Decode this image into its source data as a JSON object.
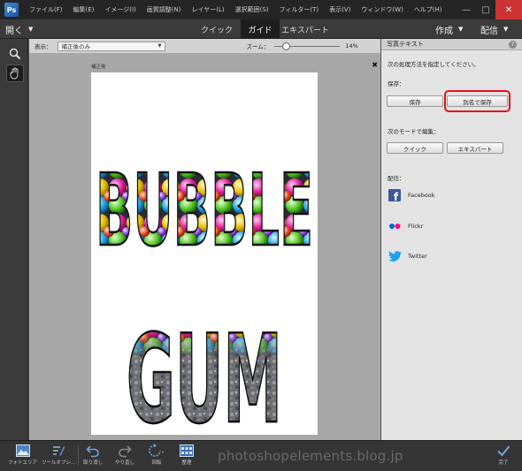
{
  "menubar": {
    "items": [
      "ファイル(F)",
      "編集(E)",
      "イメージ(I)",
      "画質調整(N)",
      "レイヤー(L)",
      "選択範囲(S)",
      "フィルター(T)",
      "表示(V)",
      "ウィンドウ(W)",
      "ヘルプ(H)"
    ]
  },
  "window": {
    "minimize": "—",
    "maximize": "□",
    "close": "✕"
  },
  "modebar": {
    "open": "開く",
    "tabs": [
      "クイック",
      "ガイド",
      "エキスパート"
    ],
    "active_tab": "ガイド",
    "create": "作成",
    "share": "配信"
  },
  "viewbar": {
    "view_label": "表示：",
    "view_value": "補正後のみ",
    "zoom_label": "ズーム：",
    "zoom_value": "14%",
    "zoom_fraction": 0.14
  },
  "document": {
    "label": "補正後",
    "close": "✖",
    "line1": "BUBBLE",
    "line2": "GUM"
  },
  "panel": {
    "title": "写真テキスト",
    "help": "?",
    "instruction": "次の処理方法を指定してください。",
    "save_heading": "保存：",
    "save_button": "保存",
    "save_as_button": "別名で保存",
    "edit_heading": "次のモードで編集：",
    "quick_button": "クイック",
    "expert_button": "エキスパート",
    "share_heading": "配信：",
    "share_items": [
      "Facebook",
      "Flickr",
      "Twitter"
    ],
    "colors": {
      "highlight": "#e0141c",
      "facebook": "#3b5998",
      "twitter": "#1da1f2"
    }
  },
  "bottombar": {
    "photo_bin": "フォトエリア",
    "tool_options": "ツールオプシ...",
    "undo": "取り消し",
    "redo": "やり直し",
    "rotate": "回転",
    "organizer": "整理",
    "done": "完了",
    "watermark": "photoshopelements.blog.jp"
  }
}
